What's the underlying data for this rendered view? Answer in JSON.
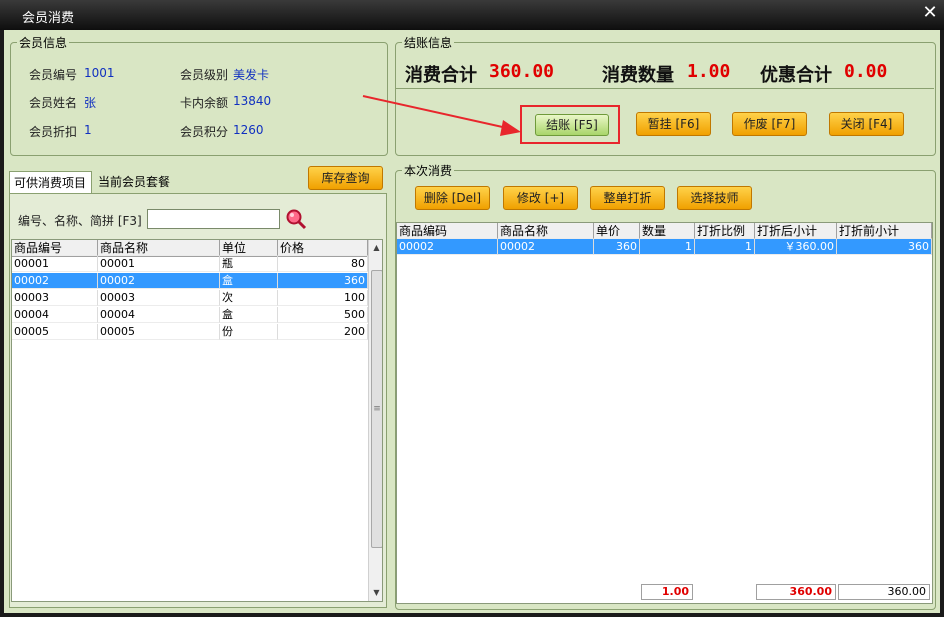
{
  "window": {
    "title": "会员消费"
  },
  "member": {
    "legend": "会员信息",
    "id_label": "会员编号",
    "id_value": "1001",
    "level_label": "会员级别",
    "level_value": "美发卡",
    "name_label": "会员姓名",
    "name_value": "张",
    "balance_label": "卡内余额",
    "balance_value": "13840",
    "discount_label": "会员折扣",
    "discount_value": "1",
    "points_label": "会员积分",
    "points_value": "1260"
  },
  "checkout": {
    "legend": "结账信息",
    "total_label": "消费合计",
    "total_value": "360.00",
    "qty_label": "消费数量",
    "qty_value": "1.00",
    "discount_label": "优惠合计",
    "discount_value": "0.00",
    "buttons": {
      "checkout": "结账 [F5]",
      "hold": "暂挂 [F6]",
      "void": "作废 [F7]",
      "close": "关闭 [F4]"
    }
  },
  "left": {
    "tabs": [
      "可供消费项目",
      "当前会员套餐"
    ],
    "stock_button": "库存查询",
    "search_label": "编号、名称、简拼 [F3]",
    "search_value": "",
    "columns": [
      "商品编号",
      "商品名称",
      "单位",
      "价格"
    ],
    "rows": [
      {
        "code": "00001",
        "name": "00001",
        "unit": "瓶",
        "price": "80"
      },
      {
        "code": "00002",
        "name": "00002",
        "unit": "盒",
        "price": "360"
      },
      {
        "code": "00003",
        "name": "00003",
        "unit": "次",
        "price": "100"
      },
      {
        "code": "00004",
        "name": "00004",
        "unit": "盒",
        "price": "500"
      },
      {
        "code": "00005",
        "name": "00005",
        "unit": "份",
        "price": "200"
      }
    ],
    "selected_index": 1
  },
  "current": {
    "legend": "本次消费",
    "buttons": {
      "delete": "删除 [Del]",
      "modify": "修改 [+]",
      "whole_discount": "整单打折",
      "technician": "选择技师"
    },
    "columns": [
      "商品编码",
      "商品名称",
      "单价",
      "数量",
      "打折比例",
      "打折后小计",
      "打折前小计"
    ],
    "rows": [
      {
        "code": "00002",
        "name": "00002",
        "price": "360",
        "qty": "1",
        "rate": "1",
        "after": "￥360.00",
        "before": "360"
      }
    ],
    "footer": {
      "qty": "1.00",
      "after": "360.00",
      "before": "360.00"
    }
  },
  "colors": {
    "panel": "#d9e6c4",
    "accent_orange": "#f0a000",
    "value_red": "#e00000",
    "value_blue": "#1030c0",
    "selection": "#3399ff",
    "annotation_red": "#e8262c"
  }
}
